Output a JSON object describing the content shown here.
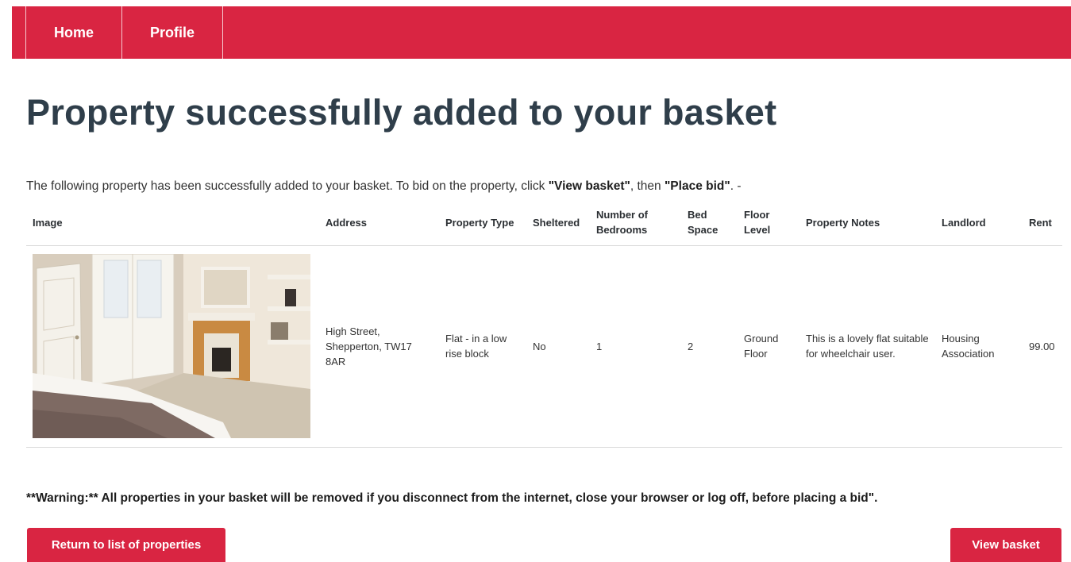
{
  "nav": {
    "items": [
      {
        "label": "Home"
      },
      {
        "label": "Profile"
      }
    ],
    "color": "#d92542"
  },
  "page_title": "Property successfully added to your basket",
  "intro": {
    "text_before": "The following property has been successfully added to your basket. To bid on the property, click ",
    "view_basket_quote": "\"View basket\"",
    "text_middle": ", then ",
    "place_bid_quote": "\"Place bid\"",
    "text_after": ". -"
  },
  "table": {
    "headers": {
      "image": "Image",
      "address": "Address",
      "property_type": "Property Type",
      "sheltered": "Sheltered",
      "bedrooms": "Number of Bedrooms",
      "bed_space": "Bed Space",
      "floor_level": "Floor Level",
      "notes": "Property Notes",
      "landlord": "Landlord",
      "rent": "Rent"
    },
    "rows": [
      {
        "image_icon": "bedroom-photo",
        "address": "High Street, Shepperton, TW17 8AR",
        "property_type": "Flat - in a low rise block",
        "sheltered": "No",
        "bedrooms": "1",
        "bed_space": "2",
        "floor_level": "Ground Floor",
        "notes": "This is a lovely flat suitable for wheelchair user.",
        "landlord": "Housing Association",
        "rent": "99.00"
      }
    ]
  },
  "warning": "**Warning:** All properties in your basket will be removed if you disconnect from the internet, close your browser or log off, before placing a bid\".",
  "buttons": {
    "return_label": "Return to list of properties",
    "view_basket_label": "View basket"
  }
}
